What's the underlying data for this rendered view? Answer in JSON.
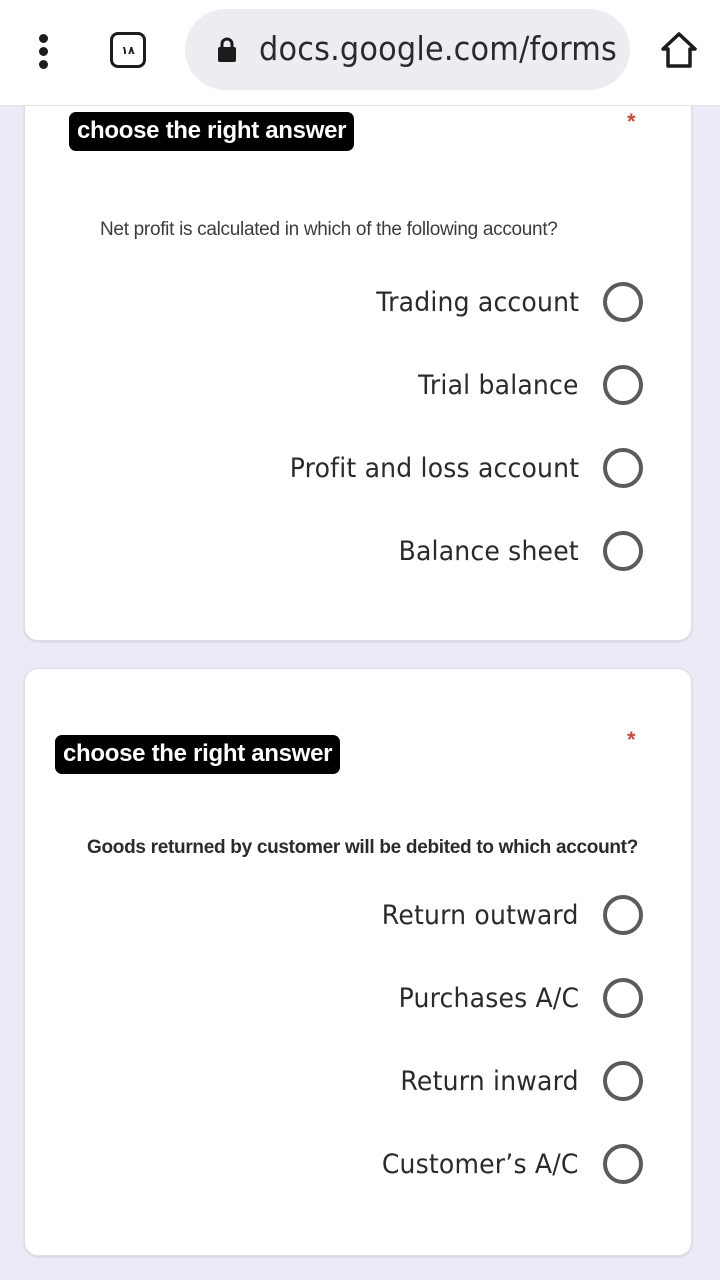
{
  "browser": {
    "menu_icon": "vertical-dots-icon",
    "tab_count": "١٨",
    "lock_icon": "lock-icon",
    "url": "docs.google.com/forms",
    "home_icon": "home-icon"
  },
  "colors": {
    "background": "#ede9f6",
    "card": "#ffffff",
    "required_star": "#c5473d",
    "label_bg": "#000000",
    "radio_border": "#5b5b5b"
  },
  "questions": [
    {
      "title": "choose the right answer",
      "required_marker": "*",
      "text": "Net profit is calculated in which of the following account?",
      "options": [
        {
          "label": "Trading account",
          "selected": false
        },
        {
          "label": "Trial balance",
          "selected": false
        },
        {
          "label": "Profit and loss account",
          "selected": false
        },
        {
          "label": "Balance sheet",
          "selected": false
        }
      ]
    },
    {
      "title": "choose the right answer",
      "required_marker": "*",
      "text": "Goods returned by customer will be debited to which account?",
      "options": [
        {
          "label": "Return outward",
          "selected": false
        },
        {
          "label": "Purchases A/C",
          "selected": false
        },
        {
          "label": "Return inward",
          "selected": false
        },
        {
          "label": "Customer’s A/C",
          "selected": false
        }
      ]
    }
  ]
}
